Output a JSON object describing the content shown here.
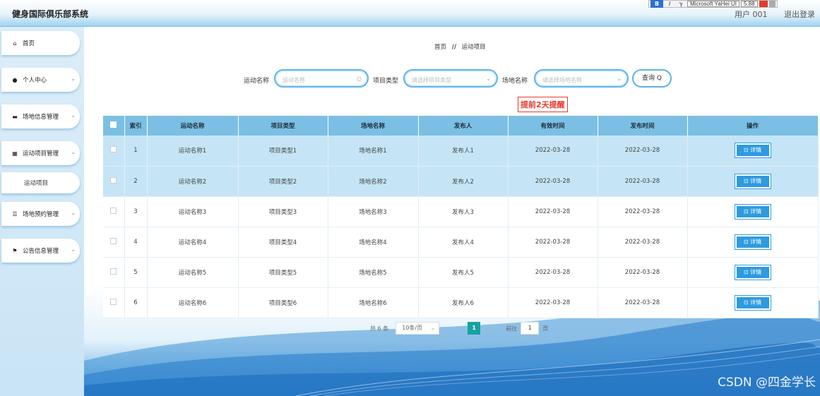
{
  "app": {
    "title": "健身国际俱乐部系统",
    "user": "用户 001",
    "logout": "退出登录"
  },
  "format_toolbar": {
    "bold": "B",
    "italic": "I",
    "clear": "ℽ",
    "font": "Microsoft YaHei UI",
    "size": "5.88"
  },
  "sidebar": {
    "items": [
      {
        "label": "首页",
        "icon": "home-icon"
      },
      {
        "label": "个人中心",
        "icon": "user-icon"
      },
      {
        "label": "场地信息管理",
        "icon": "monitor-icon"
      },
      {
        "label": "运动项目管理",
        "icon": "grid-icon"
      },
      {
        "label": "运动项目",
        "icon": ""
      },
      {
        "label": "场地预约管理",
        "icon": "list-icon"
      },
      {
        "label": "公告信息管理",
        "icon": "flag-icon"
      }
    ]
  },
  "breadcrumb": {
    "home": "首页",
    "sep": "//",
    "current": "运动项目"
  },
  "search": {
    "name_label": "运动名称",
    "name_placeholder": "运动名称",
    "type_label": "项目类型",
    "type_placeholder": "请选择项目类型",
    "venue_label": "场地名称",
    "venue_placeholder": "请选择场地名称",
    "query_button": "查询 Q"
  },
  "reminder": "提前2天提醒",
  "table": {
    "headers": [
      "索引",
      "运动名称",
      "项目类型",
      "场地名称",
      "发布人",
      "有效时间",
      "发布时间",
      "操作"
    ],
    "detail_label": "⊡ 详情",
    "rows": [
      {
        "index": "1",
        "name": "运动名称1",
        "type": "项目类型1",
        "venue": "场地名称1",
        "publisher": "发布人1",
        "valid": "2022-03-28",
        "published": "2022-03-28"
      },
      {
        "index": "2",
        "name": "运动名称2",
        "type": "项目类型2",
        "venue": "场地名称2",
        "publisher": "发布人2",
        "valid": "2022-03-28",
        "published": "2022-03-28"
      },
      {
        "index": "3",
        "name": "运动名称3",
        "type": "项目类型3",
        "venue": "场地名称3",
        "publisher": "发布人3",
        "valid": "2022-03-28",
        "published": "2022-03-28"
      },
      {
        "index": "4",
        "name": "运动名称4",
        "type": "项目类型4",
        "venue": "场地名称4",
        "publisher": "发布人4",
        "valid": "2022-03-28",
        "published": "2022-03-28"
      },
      {
        "index": "5",
        "name": "运动名称5",
        "type": "项目类型5",
        "venue": "场地名称5",
        "publisher": "发布人5",
        "valid": "2022-03-28",
        "published": "2022-03-28"
      },
      {
        "index": "6",
        "name": "运动名称6",
        "type": "项目类型6",
        "venue": "场地名称6",
        "publisher": "发布人6",
        "valid": "2022-03-28",
        "published": "2022-03-28"
      }
    ]
  },
  "pagination": {
    "total": "共 6 条",
    "page_size": "10条/页",
    "current_page": "1",
    "goto_label": "前往",
    "goto_value": "1",
    "page_suffix": "页"
  },
  "watermark": "CSDN @四金学长",
  "colors": {
    "header_bg": "#7bbfe4",
    "accent": "#2e9be0",
    "reminder": "#e43a2f",
    "page_active": "#17a2a0"
  }
}
